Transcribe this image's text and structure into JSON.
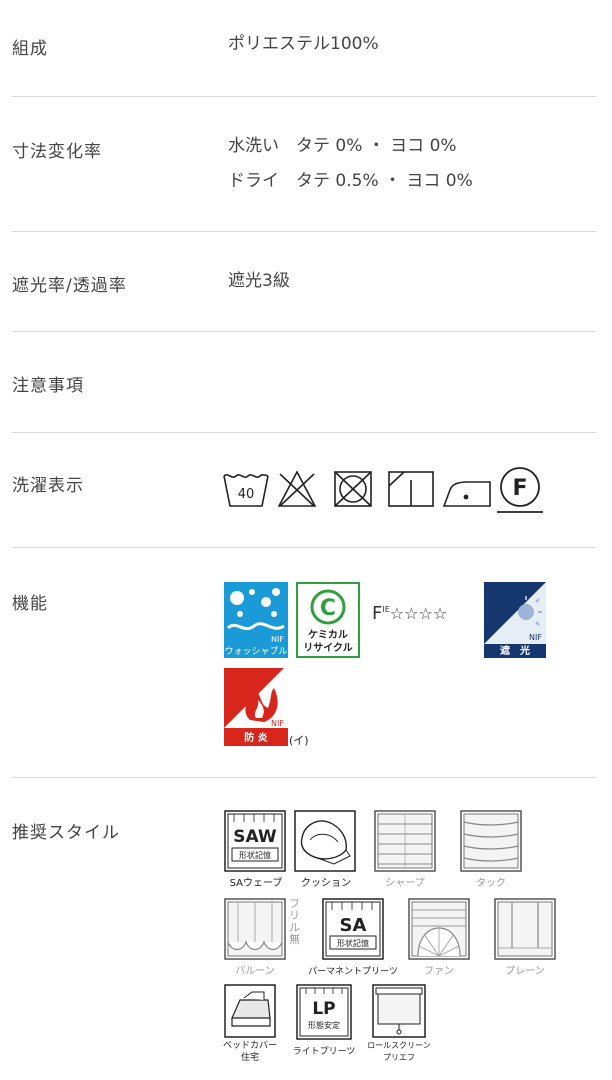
{
  "specs": {
    "composition": {
      "label": "組成",
      "value": "ポリエステル100%"
    },
    "dimension": {
      "label": "寸法変化率",
      "line1": "水洗い　タテ 0% ・ ヨコ 0%",
      "line2": "ドライ　タテ 0.5% ・ ヨコ 0%"
    },
    "shading": {
      "label": "遮光率/透過率",
      "value": "遮光3級"
    },
    "notes": {
      "label": "注意事項"
    },
    "washing": {
      "label": "洗濯表示",
      "wash_temp": "40",
      "dry_clean": "F"
    },
    "function": {
      "label": "機能",
      "washable": {
        "brand": "NIF",
        "text": "ウォッシャブル"
      },
      "chemical": {
        "letter": "C",
        "line1": "ケミカル",
        "line2": "リサイクル"
      },
      "formaldehyde": {
        "text": "F",
        "sup": "IE",
        "stars": "☆☆☆☆"
      },
      "blackout": {
        "brand": "NIF",
        "text": "遮　光"
      },
      "flameproof": {
        "brand": "NIF",
        "text": "防 炎",
        "suffix": "(イ)"
      }
    },
    "style": {
      "label": "推奨スタイル",
      "items": [
        {
          "name": "SAウェーブ",
          "icon_text": "SAW",
          "icon_sub": "形状記憶",
          "active": true
        },
        {
          "name": "クッション",
          "active": true
        },
        {
          "name": "シャープ",
          "active": false
        },
        {
          "name": "タック",
          "active": false
        },
        {
          "name": "バルーン",
          "side": "フリル無",
          "active": false
        },
        {
          "name": "パーマネントプリーツ",
          "icon_text": "SA",
          "icon_sub": "形状記憶",
          "active": true
        },
        {
          "name": "ファン",
          "active": false
        },
        {
          "name": "プレーン",
          "active": false
        },
        {
          "name": "ベッドカバー",
          "name2": "住宅",
          "active": true
        },
        {
          "name": "ライトプリーツ",
          "icon_text": "LP",
          "icon_sub": "形態安定",
          "active": true
        },
        {
          "name": "ロールスクリーン",
          "name2": "プリエフ",
          "active": true
        }
      ]
    }
  },
  "colors": {
    "nif_blue": "#1a9ad6",
    "chem_green": "#2e9e3e",
    "blackout_navy": "#15376e",
    "flame_red": "#d9261c"
  }
}
